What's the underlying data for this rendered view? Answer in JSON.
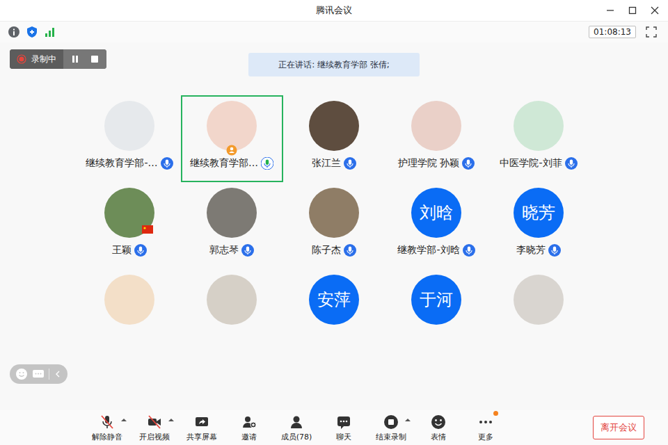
{
  "window": {
    "title": "腾讯会议"
  },
  "status": {
    "timer": "01:08:13"
  },
  "recording": {
    "label": "录制中"
  },
  "speaking_banner": "正在讲话: 继续教育学部 张倩;",
  "participants": [
    {
      "name": "继续教育学部-…",
      "avatar": {
        "kind": "photo",
        "color": "#e6e9ec"
      },
      "speaking": false,
      "host": false,
      "flag": false
    },
    {
      "name": "继续教育学部…",
      "avatar": {
        "kind": "photo",
        "color": "#f2d6cb"
      },
      "speaking": true,
      "host": true,
      "flag": false
    },
    {
      "name": "张江兰",
      "avatar": {
        "kind": "photo",
        "color": "#5e4d3f"
      },
      "speaking": false,
      "host": false,
      "flag": false
    },
    {
      "name": "护理学院 孙颖",
      "avatar": {
        "kind": "photo",
        "color": "#ead0c8"
      },
      "speaking": false,
      "host": false,
      "flag": false
    },
    {
      "name": "中医学院-刘菲",
      "avatar": {
        "kind": "photo",
        "color": "#cfe8d6"
      },
      "speaking": false,
      "host": false,
      "flag": false
    },
    {
      "name": "王颖",
      "avatar": {
        "kind": "photo",
        "color": "#6d8d58"
      },
      "speaking": false,
      "host": false,
      "flag": true
    },
    {
      "name": "郭志琴",
      "avatar": {
        "kind": "photo",
        "color": "#7d7a74"
      },
      "speaking": false,
      "host": false,
      "flag": false
    },
    {
      "name": "陈子杰",
      "avatar": {
        "kind": "photo",
        "color": "#8f7d66"
      },
      "speaking": false,
      "host": false,
      "flag": false
    },
    {
      "name": "继教学部-刘晗",
      "avatar": {
        "kind": "initials",
        "text": "刘晗"
      },
      "speaking": false,
      "host": false,
      "flag": false
    },
    {
      "name": "李晓芳",
      "avatar": {
        "kind": "initials",
        "text": "晓芳"
      },
      "speaking": false,
      "host": false,
      "flag": false
    },
    {
      "avatar": {
        "kind": "photo",
        "color": "#f3dfc8"
      },
      "speaking": false,
      "host": false,
      "flag": false
    },
    {
      "avatar": {
        "kind": "photo",
        "color": "#d6d0c7"
      },
      "speaking": false,
      "host": false,
      "flag": false
    },
    {
      "avatar": {
        "kind": "initials",
        "text": "安萍"
      },
      "speaking": false,
      "host": false,
      "flag": false
    },
    {
      "avatar": {
        "kind": "initials",
        "text": "于河"
      },
      "speaking": false,
      "host": false,
      "flag": false
    },
    {
      "avatar": {
        "kind": "photo",
        "color": "#d9d5d0"
      },
      "speaking": false,
      "host": false,
      "flag": false
    }
  ],
  "toolbar": [
    {
      "label": "解除静音",
      "off": true,
      "caret": true,
      "notify": false
    },
    {
      "label": "开启视频",
      "off": true,
      "caret": true,
      "notify": false
    },
    {
      "label": "共享屏幕",
      "off": false,
      "caret": false,
      "notify": false
    },
    {
      "label": "邀请",
      "off": false,
      "caret": false,
      "notify": false
    },
    {
      "label": "成员(78)",
      "off": false,
      "caret": false,
      "notify": false
    },
    {
      "label": "聊天",
      "off": false,
      "caret": false,
      "notify": false
    },
    {
      "label": "结束录制",
      "off": false,
      "caret": true,
      "notify": false
    },
    {
      "label": "表情",
      "off": false,
      "caret": false,
      "notify": false
    },
    {
      "label": "更多",
      "off": false,
      "caret": false,
      "notify": true
    }
  ],
  "leave_button": "离开会议"
}
